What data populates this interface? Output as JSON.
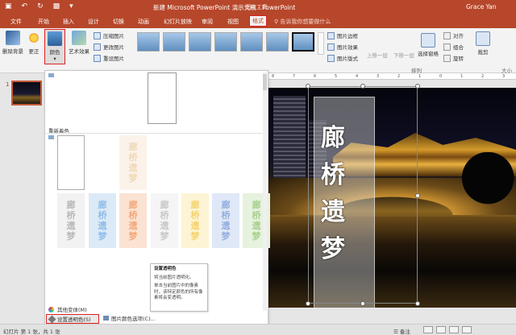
{
  "window": {
    "title": "新建 Microsoft PowerPoint 演示文稿 - PowerPoint",
    "tools_label": "图片工具",
    "user": "Grace Yan"
  },
  "tabs": [
    {
      "label": "文件"
    },
    {
      "label": "开始"
    },
    {
      "label": "插入"
    },
    {
      "label": "设计"
    },
    {
      "label": "切换"
    },
    {
      "label": "动画"
    },
    {
      "label": "幻灯片放映"
    },
    {
      "label": "审阅"
    },
    {
      "label": "视图"
    },
    {
      "label": "格式"
    }
  ],
  "tell_me": "告诉我你想要做什么",
  "ribbon": {
    "remove_bg": "删除背景",
    "corrections": "更正",
    "color": "颜色",
    "artistic": "艺术效果",
    "compress": "压缩图片",
    "change_pic": "更改图片",
    "reset_pic": "重设图片",
    "border": "图片边框",
    "effects": "图片效果",
    "layout": "图片版式",
    "bring_forward": "上移一层",
    "send_backward": "下移一层",
    "selection_pane": "选择窗格",
    "align": "对齐",
    "group": "组合",
    "rotate": "旋转",
    "crop": "裁剪",
    "arrange_label": "排列",
    "size_label": "大小"
  },
  "thumbnail": {
    "slide_number": "1"
  },
  "color_menu": {
    "recolor_label": "重新着色",
    "more_variations": "其他变体(M)",
    "set_transparent": "设置透明色(S)",
    "picture_color_options": "图片颜色选项(C)...",
    "swatch_text": [
      "廊",
      "桥",
      "遗",
      "梦"
    ],
    "swatch_colors": [
      "#9b9b9b",
      "#5b9bd5",
      "#ed7d31",
      "#a5a5a5",
      "#ffc000",
      "#4472c4",
      "#70ad47"
    ]
  },
  "tooltip": {
    "title": "设置透明色",
    "line1": "将当前图片透明化。",
    "line2": "单击当前图片中的像素时，该特定颜色的所有像素将会变透明。"
  },
  "slide": {
    "poem": [
      "廊",
      "桥",
      "遗",
      "梦"
    ]
  },
  "ruler": [
    "8",
    "7",
    "6",
    "5",
    "4",
    "3",
    "2",
    "1",
    "0",
    "1",
    "2",
    "3"
  ],
  "statusbar": {
    "slide_info": "幻灯片 第 1 张，共 1 张",
    "notes": "备注"
  }
}
